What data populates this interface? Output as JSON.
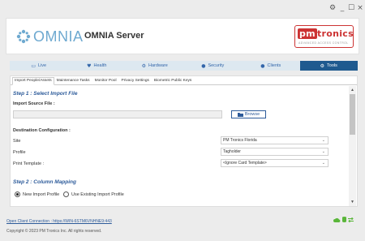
{
  "window": {
    "settings_icon": "gear-icon",
    "minimize": "_",
    "maximize": "☐",
    "close": "×"
  },
  "header": {
    "logo_text": "OMNIA",
    "app_title": "OMNIA Server",
    "brand_name_pm": "pm",
    "brand_name_rest": "tronics",
    "brand_tagline": "ADVANCED ACCESS CONTROL"
  },
  "nav": {
    "tabs": [
      {
        "label": "Live",
        "icon": "monitor-icon",
        "glyph": "▭"
      },
      {
        "label": "Health",
        "icon": "heart-icon",
        "glyph": "♥"
      },
      {
        "label": "Hardware",
        "icon": "cogs-icon",
        "glyph": "⚙"
      },
      {
        "label": "Security",
        "icon": "user-icon",
        "glyph": "●"
      },
      {
        "label": "Clients",
        "icon": "user-icon",
        "glyph": "●"
      },
      {
        "label": "Tools",
        "icon": "cogs-icon",
        "glyph": "⚙",
        "active": true
      }
    ]
  },
  "subtabs": [
    {
      "label": "Import People/Assets",
      "active": true
    },
    {
      "label": "Maintenance Tasks"
    },
    {
      "label": "Monitor Pool"
    },
    {
      "label": "Privacy Settings"
    },
    {
      "label": "Biometric Public Keys"
    }
  ],
  "form": {
    "step1_title": "Step 1 : Select Import File",
    "import_source_label": "Import Source File :",
    "import_source_value": "",
    "browse_label": "Browse",
    "dest_config_label": "Destination Configuration :",
    "site_label": "Site",
    "site_value": "PM Tronics Florida",
    "profile_label": "Profile",
    "profile_value": "Tagholder",
    "print_template_label": "Print Template :",
    "print_template_value": "<Ignore Card Template>",
    "step2_title": "Step 2 : Column Mapping",
    "radio_new_label": "New Import Profile",
    "radio_existing_label": "Use Existing Import Profile",
    "radio_selected": "new"
  },
  "footer": {
    "connection_link": "Open Client Connection : https://WIN-6STM6VNHNE9:443",
    "copyright": "Copyright © 2023 PM Tronics Inc. All rights reserved."
  }
}
